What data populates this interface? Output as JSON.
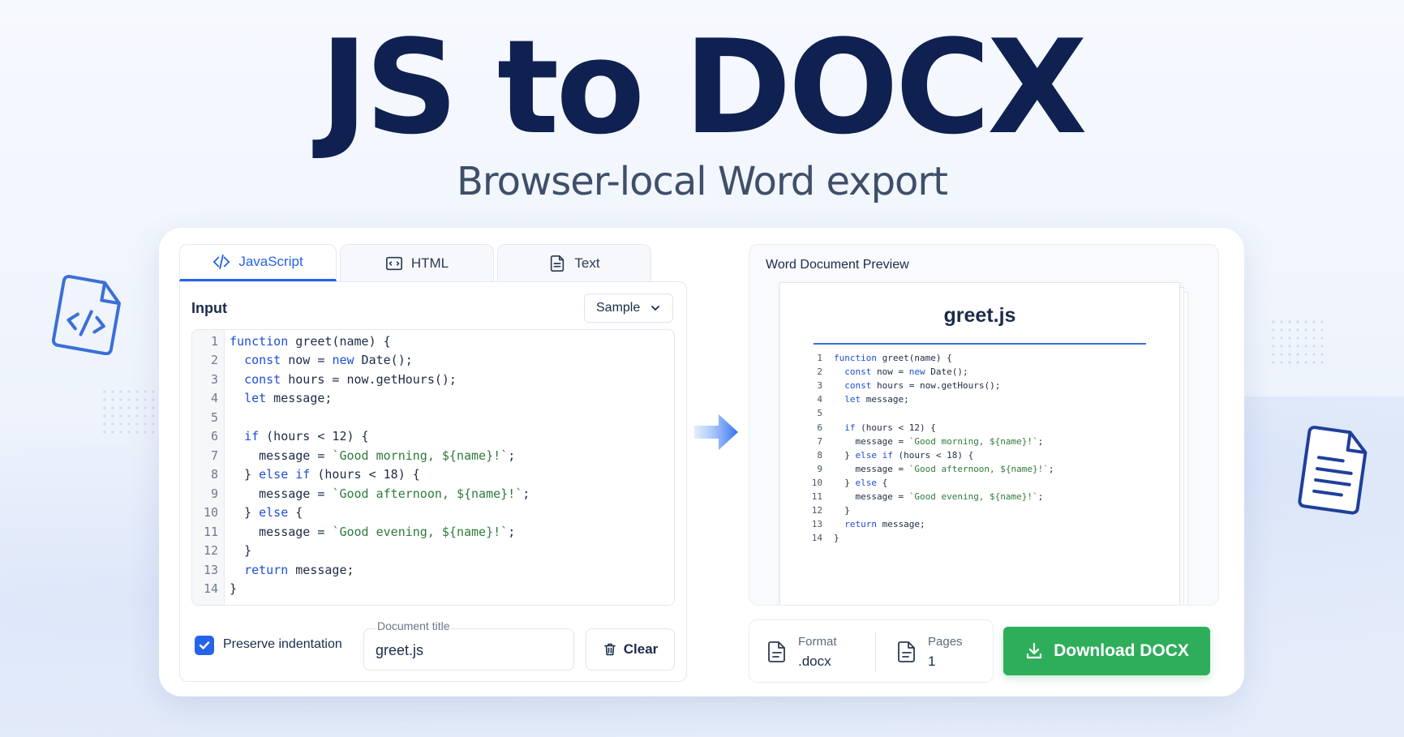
{
  "hero": {
    "title": "JS to DOCX",
    "subtitle": "Browser-local Word export"
  },
  "tabs": [
    {
      "label": "JavaScript",
      "icon": "code-icon",
      "active": true
    },
    {
      "label": "HTML",
      "icon": "html-icon",
      "active": false
    },
    {
      "label": "Text",
      "icon": "text-file-icon",
      "active": false
    }
  ],
  "input": {
    "label": "Input",
    "sample_select": "Sample",
    "code_lines": [
      {
        "n": "1",
        "text": "function greet(name) {"
      },
      {
        "n": "2",
        "text": "  const now = new Date();"
      },
      {
        "n": "3",
        "text": "  const hours = now.getHours();"
      },
      {
        "n": "4",
        "text": "  let message;"
      },
      {
        "n": "5",
        "text": ""
      },
      {
        "n": "6",
        "text": "  if (hours < 12) {"
      },
      {
        "n": "7",
        "text": "    message = `Good morning, ${name}!`;"
      },
      {
        "n": "8",
        "text": "  } else if (hours < 18) {"
      },
      {
        "n": "9",
        "text": "    message = `Good afternoon, ${name}!`;"
      },
      {
        "n": "10",
        "text": "  } else {"
      },
      {
        "n": "11",
        "text": "    message = `Good evening, ${name}!`;"
      },
      {
        "n": "12",
        "text": "  }"
      },
      {
        "n": "13",
        "text": "  return message;"
      },
      {
        "n": "14",
        "text": "}"
      }
    ],
    "preserve_indentation_label": "Preserve indentation",
    "preserve_indentation_checked": true,
    "document_title_label": "Document title",
    "document_title_value": "greet.js",
    "clear_label": "Clear"
  },
  "preview": {
    "label": "Word Document Preview",
    "doc_title": "greet.js"
  },
  "info": {
    "format_key": "Format",
    "format_value": ".docx",
    "pages_key": "Pages",
    "pages_value": "1"
  },
  "download_label": "Download DOCX",
  "colors": {
    "accent": "#2563eb",
    "title": "#0f2150",
    "download": "#2eae5b",
    "keyword": "#1d4ed8",
    "string": "#2f7a3a"
  }
}
